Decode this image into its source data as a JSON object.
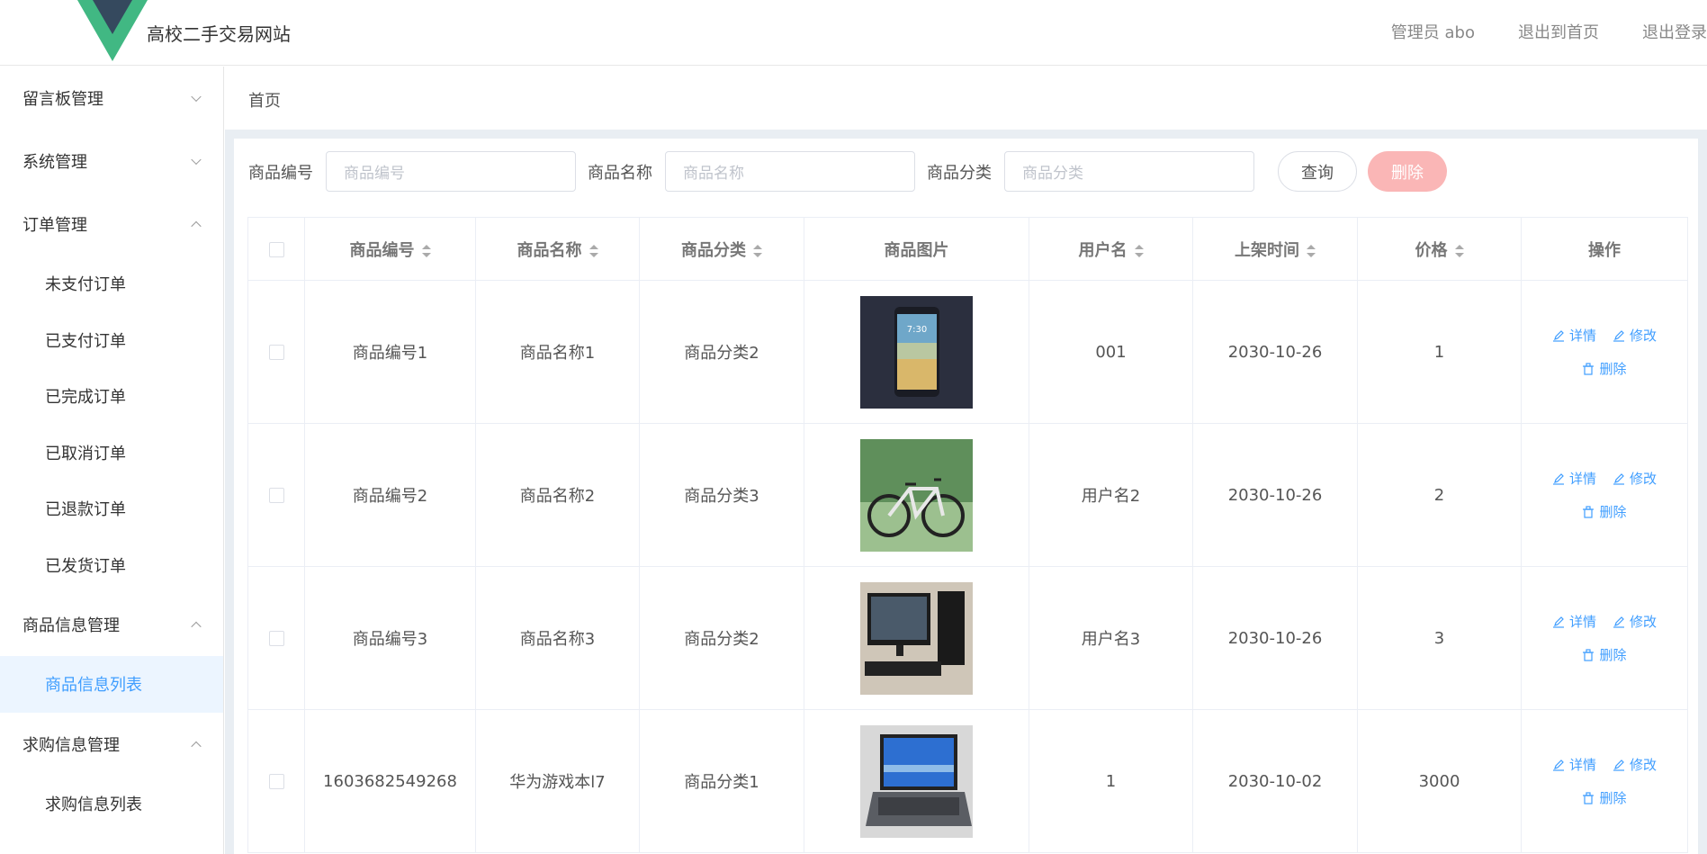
{
  "header": {
    "title": "高校二手交易网站",
    "admin": "管理员 abo",
    "exit_home": "退出到首页",
    "logout": "退出登录",
    "logo_colors": {
      "outer": "#41b883",
      "inner": "#35495e"
    }
  },
  "sidebar": {
    "groups": [
      {
        "label": "留言板管理",
        "expanded": false
      },
      {
        "label": "系统管理",
        "expanded": false
      },
      {
        "label": "订单管理",
        "expanded": true,
        "items": [
          "未支付订单",
          "已支付订单",
          "已完成订单",
          "已取消订单",
          "已退款订单",
          "已发货订单"
        ]
      },
      {
        "label": "商品信息管理",
        "expanded": true,
        "items": [
          "商品信息列表"
        ]
      },
      {
        "label": "求购信息管理",
        "expanded": true,
        "items": [
          "求购信息列表"
        ]
      }
    ],
    "active_item": "商品信息列表"
  },
  "breadcrumb": "首页",
  "search": {
    "code_label": "商品编号",
    "code_placeholder": "商品编号",
    "name_label": "商品名称",
    "name_placeholder": "商品名称",
    "category_label": "商品分类",
    "category_placeholder": "商品分类",
    "query_button": "查询",
    "delete_button": "删除"
  },
  "table": {
    "columns": [
      "商品编号",
      "商品名称",
      "商品分类",
      "商品图片",
      "用户名",
      "上架时间",
      "价格",
      "操作"
    ],
    "rows": [
      {
        "code": "商品编号1",
        "name": "商品名称1",
        "category": "商品分类2",
        "image": "smartphone",
        "user": "001",
        "date": "2030-10-26",
        "price": "1"
      },
      {
        "code": "商品编号2",
        "name": "商品名称2",
        "category": "商品分类3",
        "image": "bicycle",
        "user": "用户名2",
        "date": "2030-10-26",
        "price": "2"
      },
      {
        "code": "商品编号3",
        "name": "商品名称3",
        "category": "商品分类2",
        "image": "desktop-computer",
        "user": "用户名3",
        "date": "2030-10-26",
        "price": "3"
      },
      {
        "code": "1603682549268",
        "name": "华为游戏本l7",
        "category": "商品分类1",
        "image": "laptop",
        "user": "1",
        "date": "2030-10-02",
        "price": "3000"
      }
    ],
    "actions": {
      "detail": "详情",
      "edit": "修改",
      "delete": "删除"
    }
  }
}
